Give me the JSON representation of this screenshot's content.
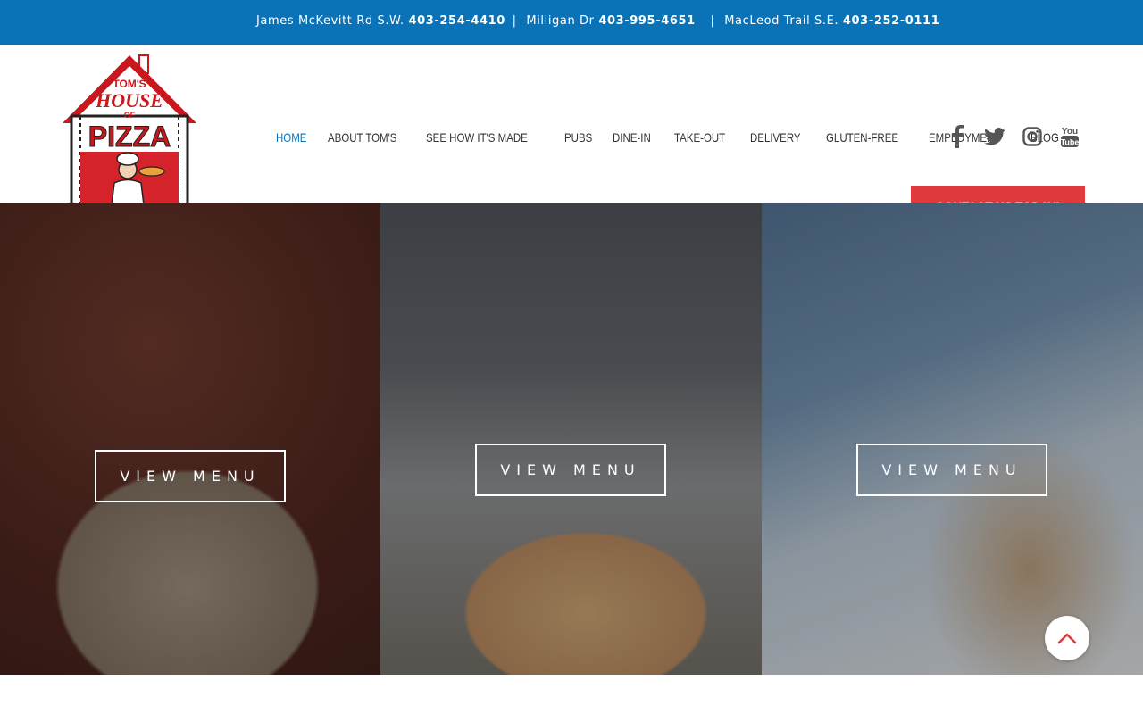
{
  "topbar": {
    "locations": [
      {
        "name": "James McKevitt Rd S.W.",
        "phone": "403-254-4410"
      },
      {
        "name": "Milligan Dr",
        "phone": "403-995-4651"
      },
      {
        "name": "MacLeod Trail S.E.",
        "phone": "403-252-0111"
      }
    ],
    "separator": "|"
  },
  "logo": {
    "line1": "TOM'S",
    "line2": "HOUSE",
    "line3": "OF",
    "line4": "PIZZA"
  },
  "nav": {
    "items": [
      {
        "label": "HOME",
        "active": true
      },
      {
        "label": "ABOUT TOM'S"
      },
      {
        "label": "SEE HOW IT'S MADE"
      },
      {
        "label": "PUBS"
      },
      {
        "label": "DINE-IN"
      },
      {
        "label": "TAKE-OUT"
      },
      {
        "label": "DELIVERY"
      },
      {
        "label": "GLUTEN-FREE"
      },
      {
        "label": "EMPLOYMENT"
      },
      {
        "label": "BLOG"
      }
    ]
  },
  "social": {
    "icons": [
      "facebook-icon",
      "twitter-icon",
      "instagram-icon",
      "youtube-icon"
    ],
    "youtube_top": "You",
    "youtube_bottom": "Tube"
  },
  "cta": {
    "label": "CONTACT US TODAY!"
  },
  "panels": [
    {
      "button": "VIEW MENU",
      "image": "mushroom pizza on wooden table"
    },
    {
      "button": "VIEW MENU",
      "image": "pizza with peppers in restaurant"
    },
    {
      "button": "VIEW MENU",
      "image": "delivery person holding pizza boxes"
    }
  ],
  "colors": {
    "primary_blue": "#0a72b6",
    "cta_red": "#e03a3e",
    "nav_text": "#333333"
  }
}
